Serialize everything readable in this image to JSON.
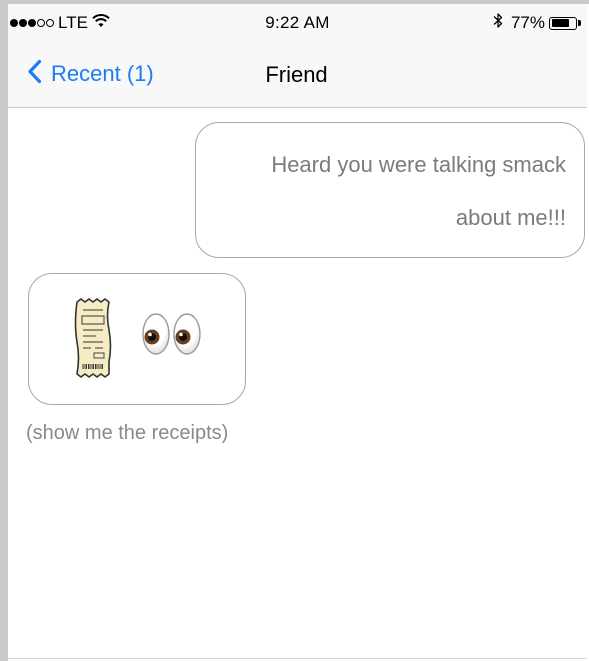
{
  "status_bar": {
    "carrier": "LTE",
    "time": "9:22 AM",
    "battery_percent": "77%",
    "battery_level": 0.77,
    "signal_bars": 3,
    "signal_total": 5
  },
  "nav": {
    "back_label": "Recent (1)",
    "title": "Friend",
    "accent_color": "#1a7cf5"
  },
  "messages": [
    {
      "direction": "outgoing",
      "lines": [
        "Heard you were talking smack",
        "about me!!!"
      ]
    },
    {
      "direction": "incoming",
      "emoji": [
        "receipt-icon",
        "eyes-icon"
      ],
      "caption": "(show me the receipts)"
    }
  ]
}
